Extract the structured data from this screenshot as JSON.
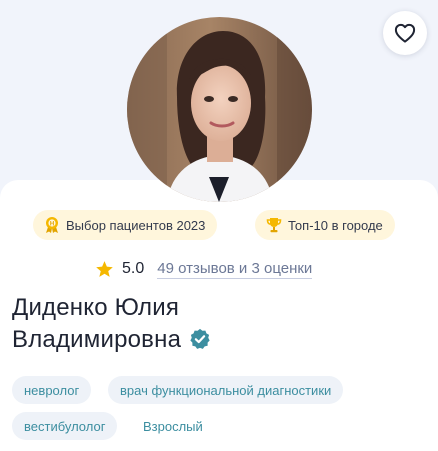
{
  "profile": {
    "name_line1": "Диденко Юлия",
    "name_line2": "Владимировна",
    "verified": true
  },
  "badges": [
    {
      "label": "Выбор пациентов 2023",
      "icon": "award-medal-icon"
    },
    {
      "label": "Топ-10 в городе",
      "icon": "trophy-icon"
    }
  ],
  "rating": {
    "score": "5.0",
    "reviews_link": "49 отзывов и 3 оценки",
    "star_color": "#f5b800"
  },
  "specialties": [
    {
      "label": "невролог"
    },
    {
      "label": "врач функциональной диагностики"
    },
    {
      "label": "вестибулолог"
    },
    {
      "label": "Взрослый"
    }
  ],
  "colors": {
    "accent_teal": "#3c8ea0",
    "badge_bg": "#fff6dc",
    "hero_bg": "#f1f4fb",
    "verified": "#3c8ea0"
  },
  "icons": [
    "heart-icon",
    "award-medal-icon",
    "trophy-icon",
    "star-icon",
    "verified-check-icon"
  ]
}
